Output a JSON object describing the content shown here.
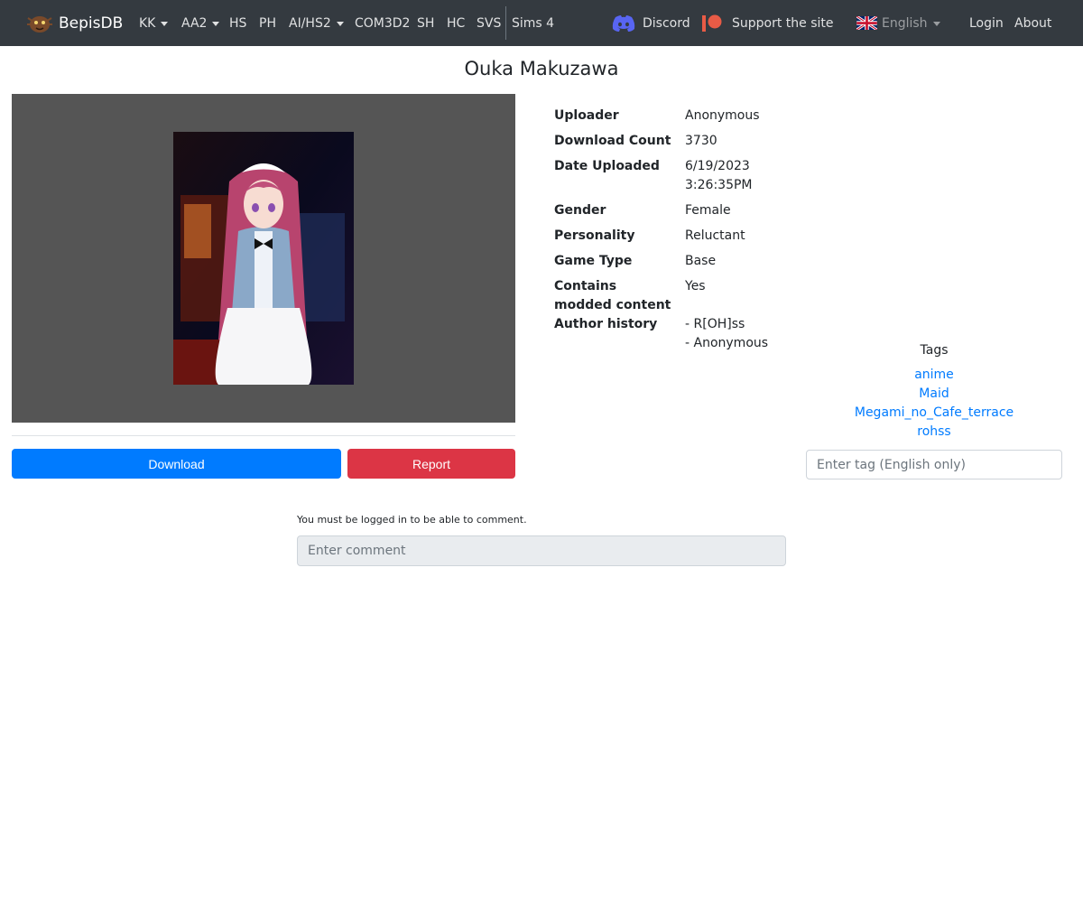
{
  "nav": {
    "brand": "BepisDB",
    "games": [
      {
        "label": "KK",
        "dropdown": true
      },
      {
        "label": "AA2",
        "dropdown": true
      },
      {
        "label": "HS",
        "dropdown": false
      },
      {
        "label": "PH",
        "dropdown": false
      },
      {
        "label": "AI/HS2",
        "dropdown": true
      },
      {
        "label": "COM3D2",
        "dropdown": false
      },
      {
        "label": "SH",
        "dropdown": false
      },
      {
        "label": "HC",
        "dropdown": false
      },
      {
        "label": "SVS",
        "dropdown": false
      },
      {
        "label": "Sims 4",
        "dropdown": false
      }
    ],
    "discord": "Discord",
    "support": "Support the site",
    "language": "English",
    "login": "Login",
    "about": "About"
  },
  "card": {
    "title": "Ouka Makuzawa",
    "download_label": "Download",
    "report_label": "Report"
  },
  "info": [
    {
      "label": "Uploader",
      "value": "Anonymous"
    },
    {
      "label": "Download Count",
      "value": "3730"
    },
    {
      "label": "Date Uploaded",
      "value": "6/19/2023\n3:26:35PM"
    },
    {
      "label": "Gender",
      "value": "Female"
    },
    {
      "label": "Personality",
      "value": "Reluctant"
    },
    {
      "label": "Game Type",
      "value": "Base"
    },
    {
      "label": "Contains\nmodded content",
      "value": "Yes"
    },
    {
      "label": "Author history",
      "value": "- R[OH]ss\n- Anonymous"
    }
  ],
  "tags": {
    "heading": "Tags",
    "items": [
      "anime",
      "Maid",
      "Megami_no_Cafe_terrace",
      "rohss"
    ],
    "placeholder": "Enter tag (English only)"
  },
  "comments": {
    "note": "You must be logged in to be able to comment.",
    "placeholder": "Enter comment"
  },
  "colors": {
    "navbar": "#343a40",
    "primary": "#007bff",
    "danger": "#dc3545",
    "image_bg": "#555555"
  }
}
